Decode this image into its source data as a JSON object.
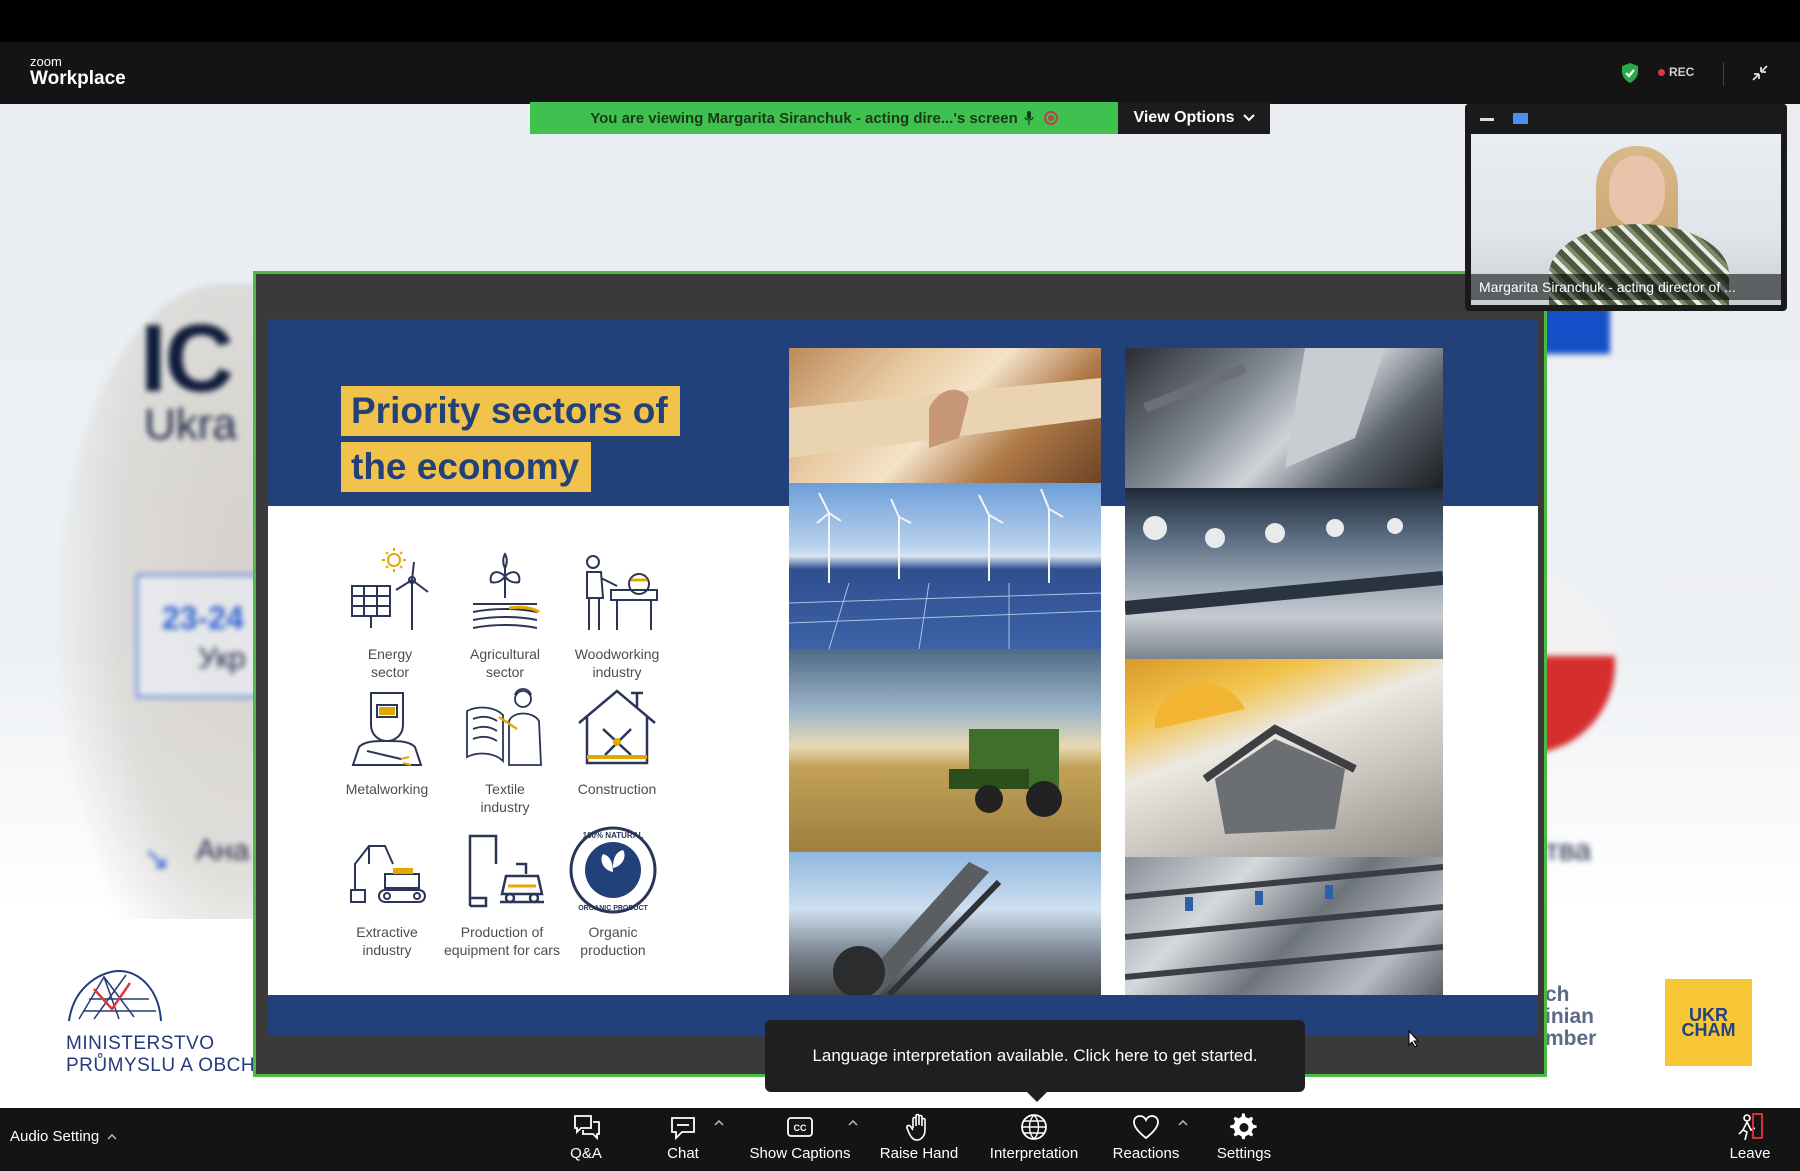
{
  "app": {
    "logo_small": "zoom",
    "logo_big": "Workplace",
    "rec_label": "REC",
    "colors": {
      "accent_green": "#4cbb46",
      "rec_red": "#e5343b",
      "toolbar_bg": "#141414"
    }
  },
  "share_banner": {
    "text": "You are viewing  Margarita Siranchuk - acting dire...'s screen",
    "view_options": "View Options"
  },
  "background_slide": {
    "title_fragment": "IC",
    "subtitle_fragment": "Ukra",
    "date_fragment": "23-24",
    "date_sub_fragment": "Укр",
    "left_text_fragment": "Ана",
    "right_text_fragment": "ства",
    "ministry_line1": "MINISTERSTVO",
    "ministry_line2": "PRŮMYSLU A OBCHOD",
    "chamber_text": "ch\ninian\nmber",
    "ukrcham_logo": "UKR CHAM"
  },
  "slide": {
    "title_line1": "Priority sectors of",
    "title_line2": "the economy",
    "sectors": [
      {
        "label": "Energy\nsector",
        "icon": "energy-icon"
      },
      {
        "label": "Agricultural\nsector",
        "icon": "agriculture-icon"
      },
      {
        "label": "Woodworking\nindustry",
        "icon": "woodworking-icon"
      },
      {
        "label": "Metalworking",
        "icon": "welder-icon"
      },
      {
        "label": "Textile\nindustry",
        "icon": "textile-icon"
      },
      {
        "label": "Construction",
        "icon": "construction-icon"
      },
      {
        "label": "Extractive\nindustry",
        "icon": "excavator-icon"
      },
      {
        "label": "Production of\nequipment for cars",
        "icon": "robot-arm-icon"
      },
      {
        "label": "Organic\nproduction",
        "icon": "organic-badge-icon"
      }
    ],
    "organic_badge_text": "100% NATURAL ORGANIC PRODUCT"
  },
  "participant": {
    "name": "Margarita Siranchuk - acting director of ..."
  },
  "tooltip": {
    "text": "Language interpretation available. Click here to get started."
  },
  "toolbar": {
    "audio": "Audio Setting",
    "qa": "Q&A",
    "chat": "Chat",
    "captions": "Show Captions",
    "raise_hand": "Raise Hand",
    "interpretation": "Interpretation",
    "reactions": "Reactions",
    "settings": "Settings",
    "leave": "Leave"
  }
}
